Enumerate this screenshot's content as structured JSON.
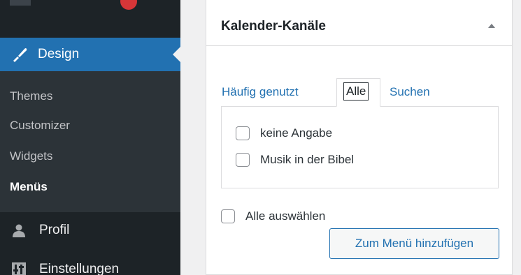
{
  "sidebar": {
    "design_label": "Design",
    "submenu": [
      "Themes",
      "Customizer",
      "Widgets",
      "Menüs"
    ],
    "profil_label": "Profil",
    "settings_label": "Einstellungen",
    "accent_color": "#2271b1",
    "notification_color": "#d63638"
  },
  "panel": {
    "title": "Kalender-Kanäle",
    "tabs": {
      "haeufig": "Häufig genutzt",
      "alle": "Alle",
      "suchen": "Suchen"
    },
    "items": [
      "keine Angabe",
      "Musik in der Bibel"
    ],
    "select_all": "Alle auswählen",
    "add_button": "Zum Menü hinzufügen"
  }
}
